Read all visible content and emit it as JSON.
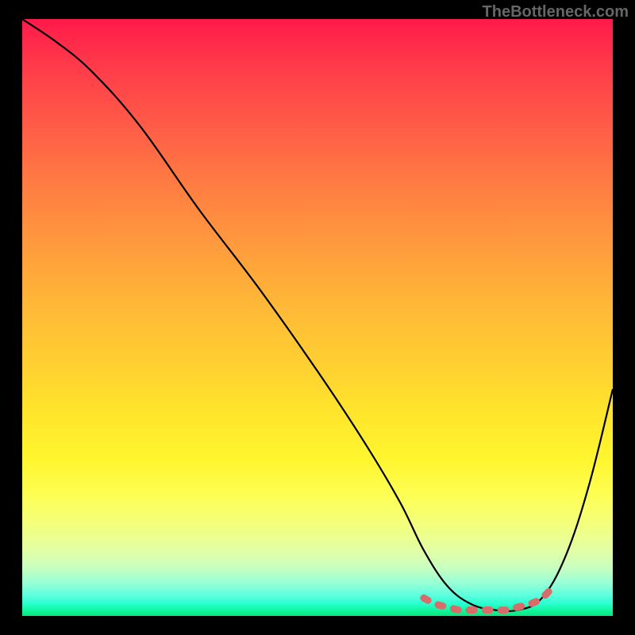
{
  "watermark": "TheBottleneck.com",
  "chart_data": {
    "type": "line",
    "title": "",
    "xlabel": "",
    "ylabel": "",
    "xlim": [
      0,
      100
    ],
    "ylim": [
      0,
      100
    ],
    "series": [
      {
        "name": "bottleneck-curve",
        "x": [
          0,
          6,
          12,
          20,
          30,
          40,
          50,
          58,
          64,
          68,
          72,
          76,
          80,
          84,
          88,
          92,
          96,
          100
        ],
        "y": [
          100,
          96,
          91,
          82,
          68,
          55,
          41,
          29,
          19,
          11,
          5,
          2,
          1,
          1,
          3,
          10,
          22,
          38
        ]
      },
      {
        "name": "optimal-range-highlight",
        "x": [
          68,
          70,
          72,
          74,
          76,
          78,
          80,
          82,
          84,
          86,
          88,
          90
        ],
        "y": [
          3,
          2,
          1.5,
          1,
          1,
          1,
          1,
          1,
          1.5,
          2,
          3,
          5
        ]
      }
    ],
    "background": {
      "type": "vertical-gradient",
      "stops": [
        {
          "pos": 0,
          "color": "#ff1a4a"
        },
        {
          "pos": 50,
          "color": "#ffb837"
        },
        {
          "pos": 80,
          "color": "#fdff56"
        },
        {
          "pos": 100,
          "color": "#0ae77a"
        }
      ]
    }
  }
}
